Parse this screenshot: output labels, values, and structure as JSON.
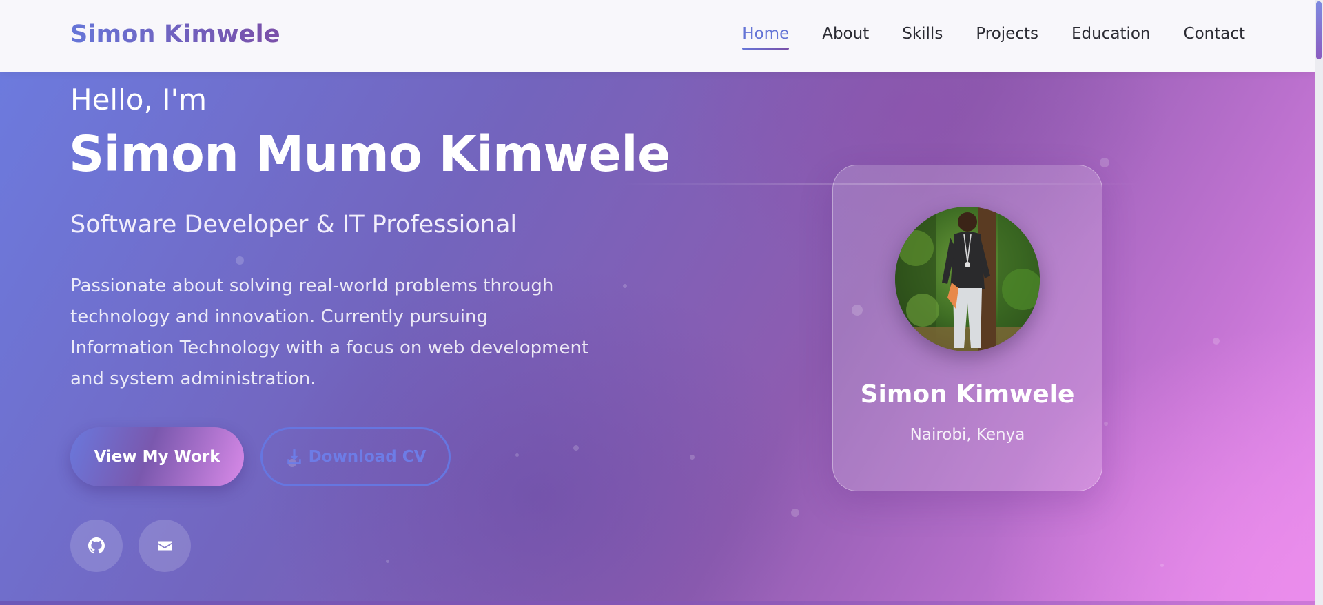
{
  "navbar": {
    "brand": "Simon Kimwele",
    "links": [
      {
        "label": "Home",
        "active": true
      },
      {
        "label": "About"
      },
      {
        "label": "Skills"
      },
      {
        "label": "Projects"
      },
      {
        "label": "Education"
      },
      {
        "label": "Contact"
      }
    ]
  },
  "hero": {
    "greeting": "Hello, I'm",
    "name": "Simon Mumo Kimwele",
    "subtitle": "Software Developer & IT Professional",
    "description": "Passionate about solving real-world problems through technology and innovation. Currently pursuing Information Technology with a focus on web development and system administration.",
    "buttons": {
      "primary": "View My Work",
      "secondary": "Download CV",
      "secondary_icon": "download-icon"
    },
    "social": [
      {
        "icon": "github-icon"
      },
      {
        "icon": "envelope-icon"
      }
    ]
  },
  "profile_card": {
    "name": "Simon Kimwele",
    "location": "Nairobi, Kenya",
    "photo": "profile-photo"
  },
  "colors": {
    "accent": "#6474d6",
    "brand_gradient_start": "#6676d8",
    "brand_gradient_end": "#7a4fa8",
    "hero_gradient_end": "#e98ff0",
    "navbar_bg": "#f8f7fb"
  }
}
